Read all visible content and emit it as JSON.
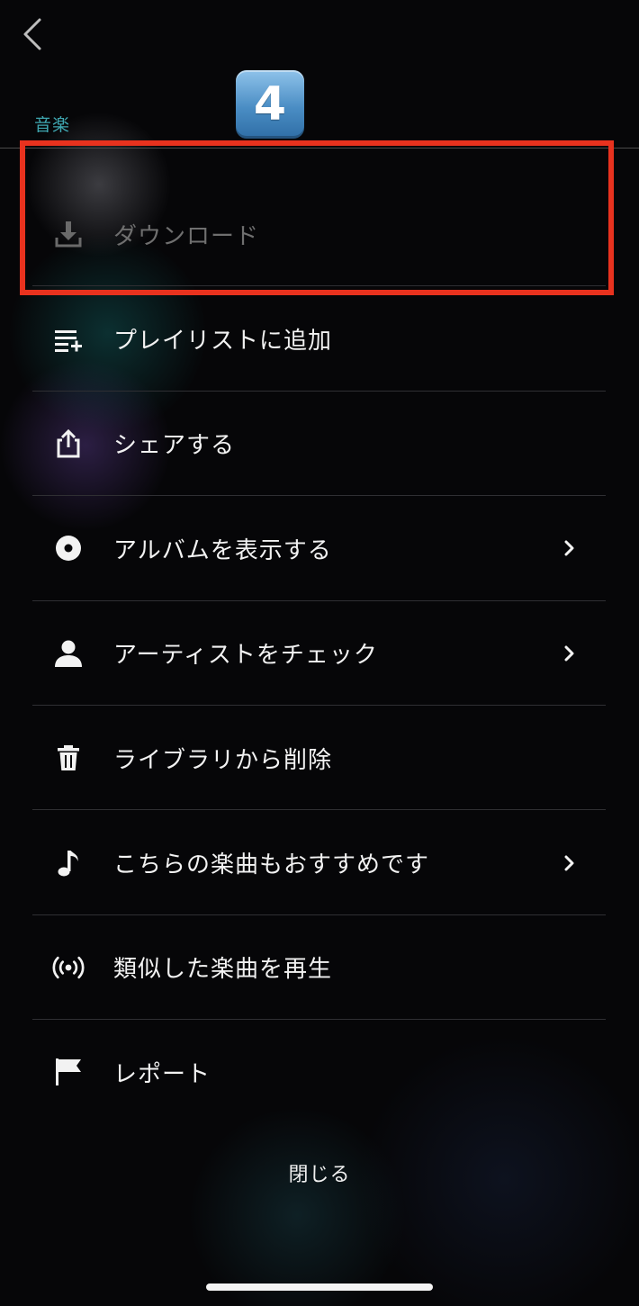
{
  "section_label": "音楽",
  "step_badge": "4",
  "menu": {
    "items": [
      {
        "label": "ダウンロード",
        "icon": "download-icon",
        "disabled": true,
        "chevron": false
      },
      {
        "label": "プレイリストに追加",
        "icon": "playlist-add-icon",
        "disabled": false,
        "chevron": false
      },
      {
        "label": "シェアする",
        "icon": "share-icon",
        "disabled": false,
        "chevron": false
      },
      {
        "label": "アルバムを表示する",
        "icon": "album-disc-icon",
        "disabled": false,
        "chevron": true
      },
      {
        "label": "アーティストをチェック",
        "icon": "person-icon",
        "disabled": false,
        "chevron": true
      },
      {
        "label": "ライブラリから削除",
        "icon": "trash-icon",
        "disabled": false,
        "chevron": false
      },
      {
        "label": "こちらの楽曲もおすすめです",
        "icon": "music-note-icon",
        "disabled": false,
        "chevron": true
      },
      {
        "label": "類似した楽曲を再生",
        "icon": "radio-broadcast-icon",
        "disabled": false,
        "chevron": false
      },
      {
        "label": "レポート",
        "icon": "flag-icon",
        "disabled": false,
        "chevron": false
      }
    ]
  },
  "close_label": "閉じる",
  "colors": {
    "section_label": "#3fa6b0",
    "highlight": "#e8321e",
    "disabled_text": "#6f6f6f",
    "badge": "#4a8dc4"
  }
}
